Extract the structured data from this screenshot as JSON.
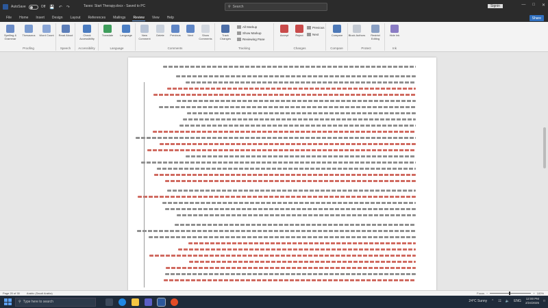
{
  "titlebar": {
    "autosave": "AutoSave",
    "autosave_state": "Off",
    "document_title": "Taxes: Start Therapy.docx - Saved to PC",
    "search_placeholder": "Search",
    "user_name": "Signin",
    "minimize": "—",
    "maximize": "□",
    "close": "✕"
  },
  "menu": {
    "tabs": [
      "File",
      "Home",
      "Insert",
      "Design",
      "Layout",
      "References",
      "Mailings",
      "Review",
      "View",
      "Help"
    ],
    "active": "Review",
    "share_label": "Share"
  },
  "ribbon": {
    "groups": [
      {
        "label": "Proofing",
        "buttons": [
          "Spelling & Grammar",
          "Thesaurus",
          "Word Count"
        ]
      },
      {
        "label": "Speech",
        "buttons": [
          "Read Aloud"
        ]
      },
      {
        "label": "Accessibility",
        "buttons": [
          "Check Accessibility"
        ]
      },
      {
        "label": "Language",
        "buttons": [
          "Translate",
          "Language"
        ]
      },
      {
        "label": "Comments",
        "buttons": [
          "New Comment",
          "Delete",
          "Previous",
          "Next",
          "Show Comments"
        ]
      },
      {
        "label": "Tracking",
        "buttons": [
          "Track Changes"
        ],
        "small": [
          "All Markup",
          "Show Markup",
          "Reviewing Pane"
        ]
      },
      {
        "label": "Changes",
        "buttons": [
          "Accept",
          "Reject"
        ],
        "small": [
          "Previous",
          "Next"
        ]
      },
      {
        "label": "Compare",
        "buttons": [
          "Compare"
        ]
      },
      {
        "label": "Protect",
        "buttons": [
          "Block Authors",
          "Restrict Editing"
        ]
      },
      {
        "label": "Ink",
        "buttons": [
          "Hide Ink"
        ]
      }
    ]
  },
  "statusbar": {
    "page": "Page 20 of 30",
    "words": "",
    "language": "Arabic (Saudi Arabia)",
    "focus": "Focus",
    "zoom": "100%"
  },
  "taskbar": {
    "search_placeholder": "Type here to search",
    "weather": "24°C  Sunny",
    "time": "12:00 PM",
    "date": "2/24/2025",
    "language": "ENG"
  },
  "colors": {
    "accent": "#2b579a",
    "titlebar": "#2b2b2b",
    "ribbon": "#f3f3f3",
    "taskbar": "#1f2b3a",
    "text_red": "#c0392b",
    "text_black": "#333333"
  }
}
